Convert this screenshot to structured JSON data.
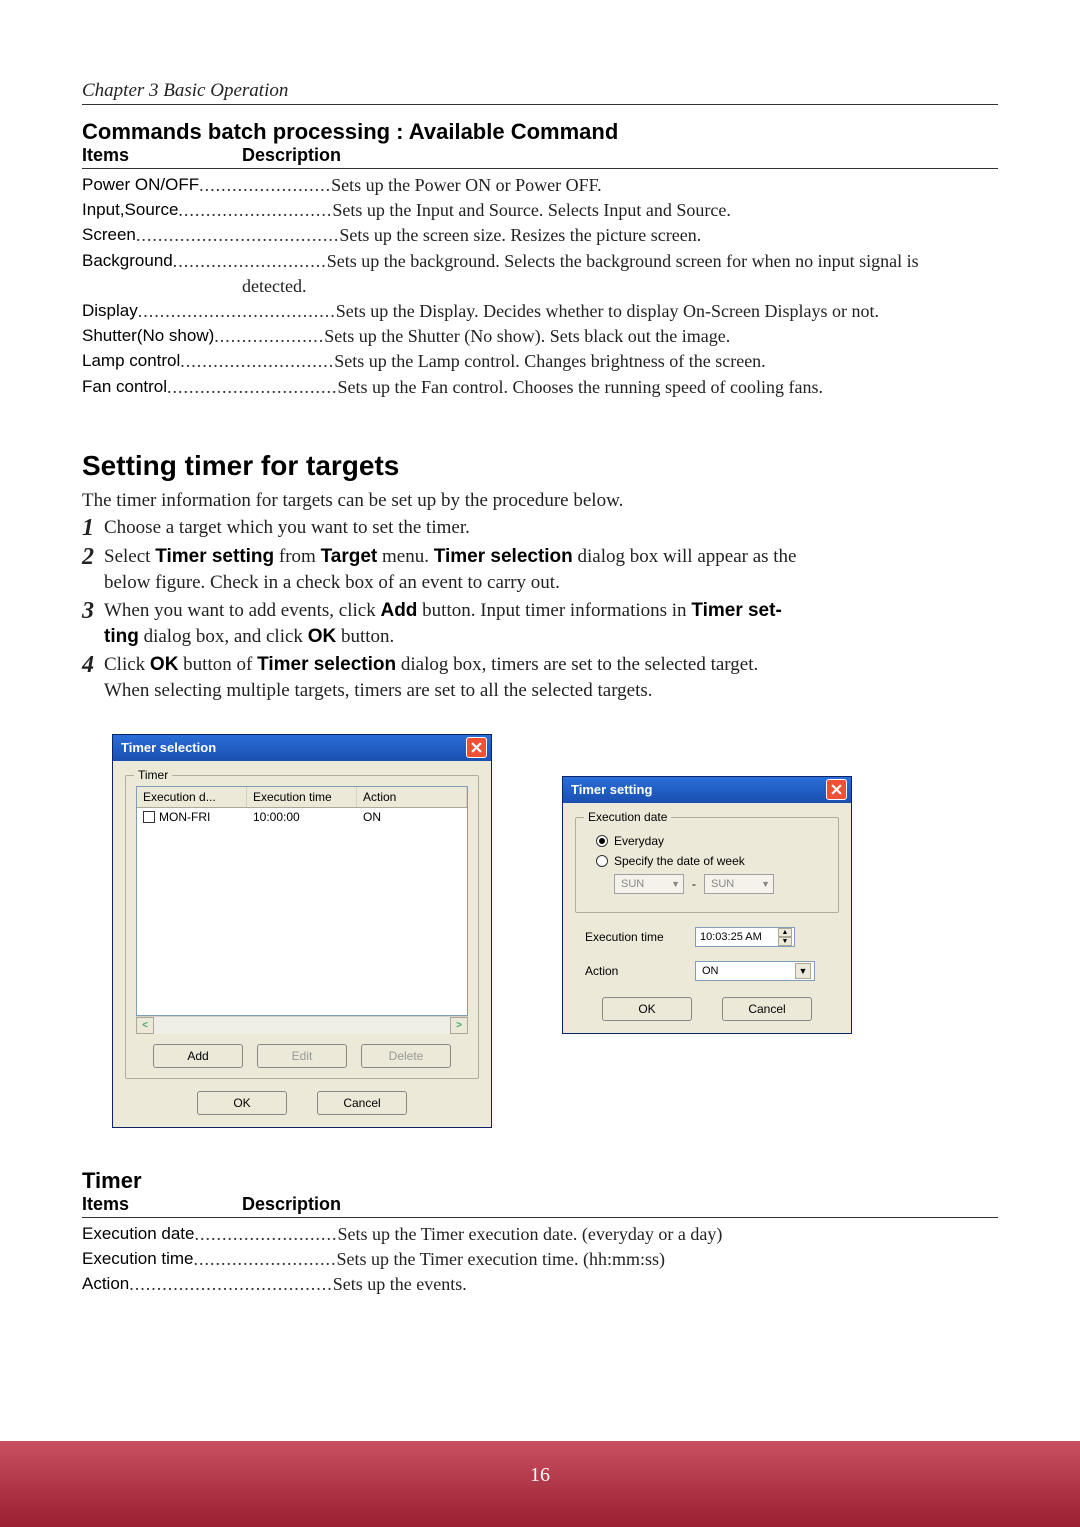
{
  "chapter": "Chapter 3 Basic Operation",
  "sec1_title": "Commands batch processing : Available Command",
  "col_items": "Items",
  "col_desc": "Description",
  "commands": [
    {
      "label": "Power ON/OFF",
      "dots": "........................",
      "desc": "Sets up the Power ON or Power OFF."
    },
    {
      "label": "Input,Source",
      "dots": "............................",
      "desc": "Sets up the Input and Source. Selects Input and Source."
    },
    {
      "label": "Screen",
      "dots": ".....................................",
      "desc": "Sets up the screen size. Resizes the picture screen."
    },
    {
      "label": "Background",
      "dots": "............................",
      "desc": "Sets up the background. Selects the background screen for when no input signal is",
      "cont": "detected."
    },
    {
      "label": "Display",
      "dots": "....................................",
      "desc": "Sets up the Display. Decides whether to display On-Screen Displays or not."
    },
    {
      "label": "Shutter(No show)",
      "dots": "....................",
      "desc": "Sets up the Shutter (No show). Sets black out the image."
    },
    {
      "label": "Lamp control",
      "dots": "............................",
      "desc": "Sets up the Lamp control. Changes brightness of the screen."
    },
    {
      "label": "Fan control",
      "dots": "...............................",
      "desc": "Sets up the Fan control. Chooses the running speed of cooling fans."
    }
  ],
  "heading2": "Setting timer for targets",
  "intro": "The timer information for targets can be set up by the procedure below.",
  "steps": {
    "s1": "Choose a target which you want to set the timer.",
    "s2a": "Select ",
    "s2b": "Timer setting",
    "s2c": " from ",
    "s2d": "Target",
    "s2e": " menu. ",
    "s2f": "Timer selection",
    "s2g": " dialog box will appear as the",
    "s2cont": "below figure. Check in a check box of an event to carry out.",
    "s3a": "When you want to add events, click ",
    "s3b": "Add",
    "s3c": " button. Input timer informations in ",
    "s3d": "Timer set-",
    "s3cont_a": "ting",
    "s3cont_b": " dialog box, and click ",
    "s3cont_c": "OK",
    "s3cont_d": " button.",
    "s4a": "Click ",
    "s4b": "OK",
    "s4c": " button of ",
    "s4d": "Timer selection",
    "s4e": " dialog box, timers are set to the selected target.",
    "s4cont": "When selecting multiple targets, timers are set to all the selected targets."
  },
  "dlg_ts": {
    "title": "Timer selection",
    "group": "Timer",
    "head": {
      "c1": "Execution d...",
      "c2": "Execution time",
      "c3": "Action"
    },
    "row": {
      "c1": "MON-FRI",
      "c2": "10:00:00",
      "c3": "ON"
    },
    "add": "Add",
    "edit": "Edit",
    "delete": "Delete",
    "ok": "OK",
    "cancel": "Cancel"
  },
  "dlg_set": {
    "title": "Timer setting",
    "group": "Execution date",
    "r1": "Everyday",
    "r2": "Specify the date of week",
    "dd": "SUN",
    "exec_time_lbl": "Execution time",
    "exec_time_val": "10:03:25 AM",
    "action_lbl": "Action",
    "action_val": "ON",
    "ok": "OK",
    "cancel": "Cancel"
  },
  "sec2_title": "Timer",
  "timer_rows": [
    {
      "label": "Execution date",
      "dots": "..........................",
      "desc": "Sets up the Timer execution date.  (everyday or a day)"
    },
    {
      "label": "Execution time",
      "dots": "..........................",
      "desc": "Sets up the Timer execution time. (hh:mm:ss)"
    },
    {
      "label": "Action",
      "dots": ".....................................",
      "desc": "Sets up the events."
    }
  ],
  "page_num": "16"
}
